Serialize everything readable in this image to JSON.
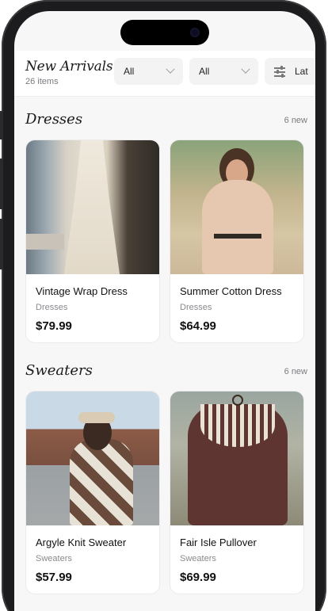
{
  "header": {
    "title": "New Arrivals",
    "count": "26 items",
    "filters": [
      {
        "label": "All"
      },
      {
        "label": "All"
      },
      {
        "label": "Lat"
      }
    ]
  },
  "sections": [
    {
      "title": "Dresses",
      "new_label": "6 new",
      "items": [
        {
          "name": "Vintage Wrap Dress",
          "category": "Dresses",
          "price": "$79.99"
        },
        {
          "name": "Summer Cotton Dress",
          "category": "Dresses",
          "price": "$64.99"
        }
      ]
    },
    {
      "title": "Sweaters",
      "new_label": "6 new",
      "items": [
        {
          "name": "Argyle Knit Sweater",
          "category": "Sweaters",
          "price": "$57.99"
        },
        {
          "name": "Fair Isle Pullover",
          "category": "Sweaters",
          "price": "$69.99"
        }
      ]
    }
  ]
}
